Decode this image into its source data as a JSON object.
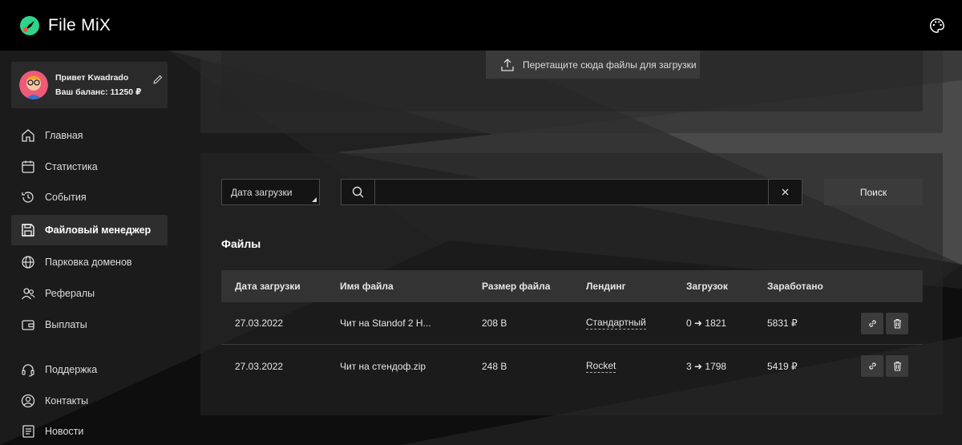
{
  "app": {
    "name": "File MiX"
  },
  "user": {
    "greeting": "Привет Kwadrado",
    "balance": "Ваш баланс: 11250 ₽"
  },
  "sidebar": {
    "items": [
      {
        "label": "Главная",
        "icon": "home-icon"
      },
      {
        "label": "Статистика",
        "icon": "calendar-icon"
      },
      {
        "label": "События",
        "icon": "history-icon"
      },
      {
        "label": "Файловый менеджер",
        "icon": "floppy-icon",
        "active": true
      },
      {
        "label": "Парковка доменов",
        "icon": "globe-icon"
      },
      {
        "label": "Рефералы",
        "icon": "users-icon"
      },
      {
        "label": "Выплаты",
        "icon": "wallet-icon"
      },
      {
        "label": "Поддержка",
        "icon": "headset-icon"
      },
      {
        "label": "Контакты",
        "icon": "contact-icon"
      },
      {
        "label": "Новости",
        "icon": "news-icon"
      }
    ]
  },
  "upload": {
    "label": "Перетащите сюда файлы для загрузки"
  },
  "filters": {
    "date_select": "Дата загрузки",
    "search_value": "",
    "search_button": "Поиск"
  },
  "files": {
    "title": "Файлы",
    "columns": [
      "Дата загрузки",
      "Имя файла",
      "Размер файла",
      "Лендинг",
      "Загрузок",
      "Заработано"
    ],
    "rows": [
      {
        "date": "27.03.2022",
        "name": "Чит на Standof 2 H...",
        "size": "208 B",
        "landing": "Стандартный",
        "downloads": "0 ➜ 1821",
        "earned": "5831 ₽"
      },
      {
        "date": "27.03.2022",
        "name": "Чит на стендоф.zip",
        "size": "248 B",
        "landing": "Rocket",
        "downloads": "3 ➜ 1798",
        "earned": "5419 ₽"
      }
    ]
  }
}
